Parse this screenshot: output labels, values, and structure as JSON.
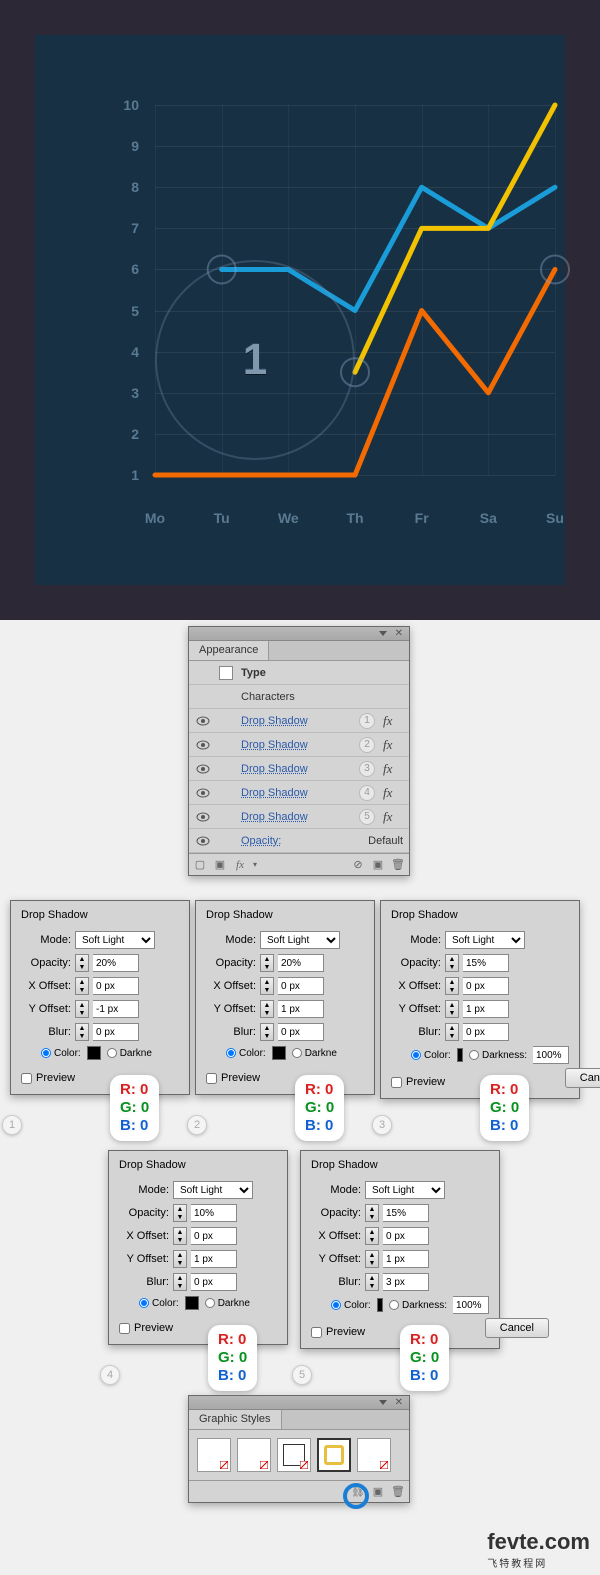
{
  "chart_data": {
    "type": "line",
    "categories": [
      "Mo",
      "Tu",
      "We",
      "Th",
      "Fr",
      "Sa",
      "Su"
    ],
    "series": [
      {
        "name": "blue",
        "color": "#1a9cd8",
        "values": [
          null,
          6,
          6,
          5,
          8,
          7,
          8
        ]
      },
      {
        "name": "yellow",
        "color": "#f2c200",
        "values": [
          null,
          null,
          null,
          3.5,
          7,
          7,
          10
        ]
      },
      {
        "name": "orange",
        "color": "#f26a00",
        "values": [
          1,
          null,
          null,
          1,
          5,
          3,
          6
        ]
      }
    ],
    "ylim": [
      1,
      10
    ],
    "ylabels": [
      "1",
      "2",
      "3",
      "4",
      "5",
      "6",
      "7",
      "8",
      "9",
      "10"
    ],
    "markers": [
      {
        "series": "blue",
        "x": "Tu",
        "y": 6
      },
      {
        "series": "yellow",
        "x": "Th",
        "y": 3.5
      },
      {
        "series": "orange",
        "x": "Su",
        "y": 6
      }
    ],
    "callout": {
      "value": "1"
    }
  },
  "appearance": {
    "title": "Appearance",
    "type_label": "Type",
    "chars_label": "Characters",
    "rows": [
      {
        "label": "Drop Shadow",
        "n": "1"
      },
      {
        "label": "Drop Shadow",
        "n": "2"
      },
      {
        "label": "Drop Shadow",
        "n": "3"
      },
      {
        "label": "Drop Shadow",
        "n": "4"
      },
      {
        "label": "Drop Shadow",
        "n": "5"
      }
    ],
    "opacity_label": "Opacity:",
    "opacity_value": "Default"
  },
  "ds_common": {
    "title": "Drop Shadow",
    "mode_label": "Mode:",
    "opacity_label": "Opacity:",
    "xoff_label": "X Offset:",
    "yoff_label": "Y Offset:",
    "blur_label": "Blur:",
    "color_label": "Color:",
    "darkness_label": "Darkness:",
    "preview_label": "Preview",
    "cancel_label": "Cancel",
    "darkness_value": "100%"
  },
  "ds": [
    {
      "n": "1",
      "mode": "Soft Light",
      "opacity": "20%",
      "x": "0 px",
      "y": "-1 px",
      "blur": "0 px"
    },
    {
      "n": "2",
      "mode": "Soft Light",
      "opacity": "20%",
      "x": "0 px",
      "y": "1 px",
      "blur": "0 px"
    },
    {
      "n": "3",
      "mode": "Soft Light",
      "opacity": "15%",
      "x": "0 px",
      "y": "1 px",
      "blur": "0 px"
    },
    {
      "n": "4",
      "mode": "Soft Light",
      "opacity": "10%",
      "x": "0 px",
      "y": "1 px",
      "blur": "0 px"
    },
    {
      "n": "5",
      "mode": "Soft Light",
      "opacity": "15%",
      "x": "0 px",
      "y": "1 px",
      "blur": "3 px"
    }
  ],
  "rgb": {
    "r": "R: 0",
    "g": "G: 0",
    "b": "B: 0"
  },
  "graphic_styles": {
    "title": "Graphic Styles"
  },
  "watermark": {
    "main": "fevte.com",
    "sub": "飞特教程网"
  }
}
